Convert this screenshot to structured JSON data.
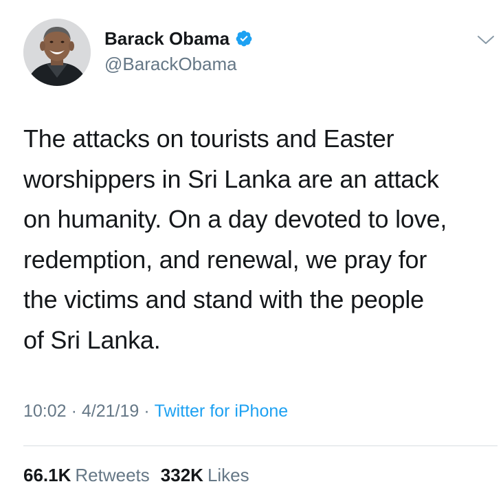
{
  "author": {
    "display_name": "Barack Obama",
    "handle": "@BarackObama",
    "verified": true,
    "avatar_icon": "profile-photo"
  },
  "tweet": {
    "lines": [
      "The attacks on tourists and Easter",
      "worshippers in Sri Lanka are an attack",
      "on humanity. On a day devoted to love,",
      "redemption, and renewal, we pray for",
      "the victims and stand with the people",
      "of Sri Lanka."
    ],
    "time": "10:02",
    "date": "4/21/19",
    "separator": "·",
    "source": "Twitter for iPhone"
  },
  "stats": {
    "retweets_count": "66.1K",
    "retweets_label": "Retweets",
    "likes_count": "332K",
    "likes_label": "Likes"
  },
  "icons": {
    "verified": "verified-badge-icon",
    "menu": "chevron-down-icon"
  },
  "colors": {
    "text": "#14171a",
    "secondary": "#657786",
    "accent": "#1da1f2",
    "divider": "#d7dde1"
  }
}
